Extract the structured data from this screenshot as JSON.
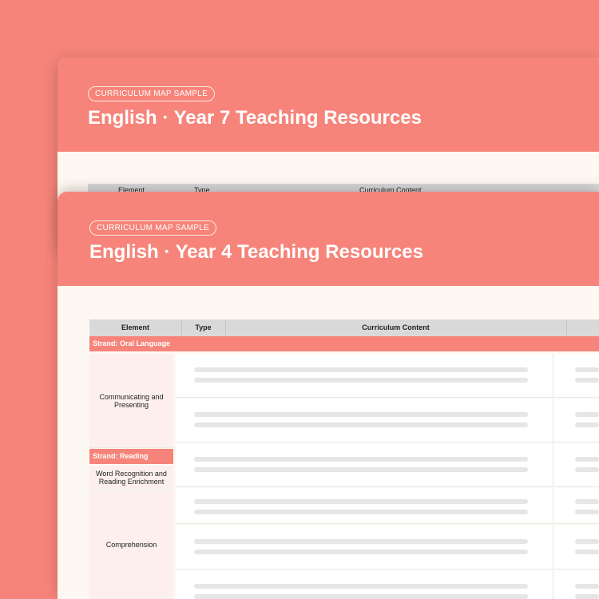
{
  "cards": [
    {
      "badge": "CURRICULUM MAP SAMPLE",
      "title": "English · Year 7 Teaching Resources",
      "columns": [
        "Element",
        "Type",
        "Curriculum Content"
      ]
    },
    {
      "badge": "CURRICULUM MAP SAMPLE",
      "title": "English · Year 4 Teaching Resources",
      "columns": [
        "Element",
        "Type",
        "Curriculum Content"
      ],
      "strands": [
        "Strand: Oral Language",
        "Strand: Reading"
      ],
      "elements": [
        "Communicating and Presenting",
        "Word Recognition and Reading Enrichment",
        "Comprehension"
      ]
    }
  ],
  "colors": {
    "accent": "#f6847a",
    "card": "#fef8f2",
    "header_row": "#d9d9d9"
  }
}
